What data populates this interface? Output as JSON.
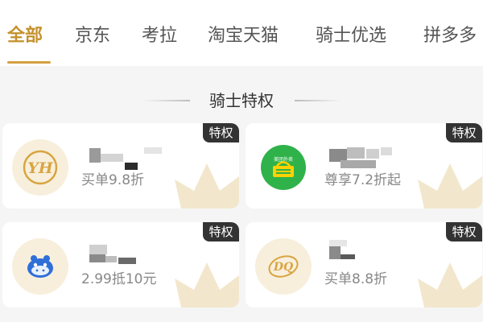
{
  "tabs": [
    {
      "label": "全部",
      "active": true
    },
    {
      "label": "京东",
      "active": false
    },
    {
      "label": "考拉",
      "active": false
    },
    {
      "label": "淘宝天猫",
      "active": false
    },
    {
      "label": "骑士优选",
      "active": false
    },
    {
      "label": "拼多多",
      "active": false
    }
  ],
  "section_title": "骑士特权",
  "colors": {
    "accent": "#c4912c",
    "underline": "#d4a040",
    "badge_bg": "#333333",
    "crown": "#f2e7cc",
    "logo_bg": "#f7efdc",
    "logo_green": "#2fb24a"
  },
  "cards": [
    {
      "badge": "特权",
      "logo_icon": "yh-logo-icon",
      "logo_text": "YH",
      "benefit": "买单9.8折"
    },
    {
      "badge": "特权",
      "logo_icon": "meituan-waimai-logo-icon",
      "logo_text": "美团外卖",
      "benefit": "尊享7.2折起"
    },
    {
      "badge": "特权",
      "logo_icon": "hippo-logo-icon",
      "benefit": "2.99抵10元"
    },
    {
      "badge": "特权",
      "logo_icon": "dq-logo-icon",
      "logo_text": "DQ",
      "benefit": "买单8.8折"
    }
  ]
}
